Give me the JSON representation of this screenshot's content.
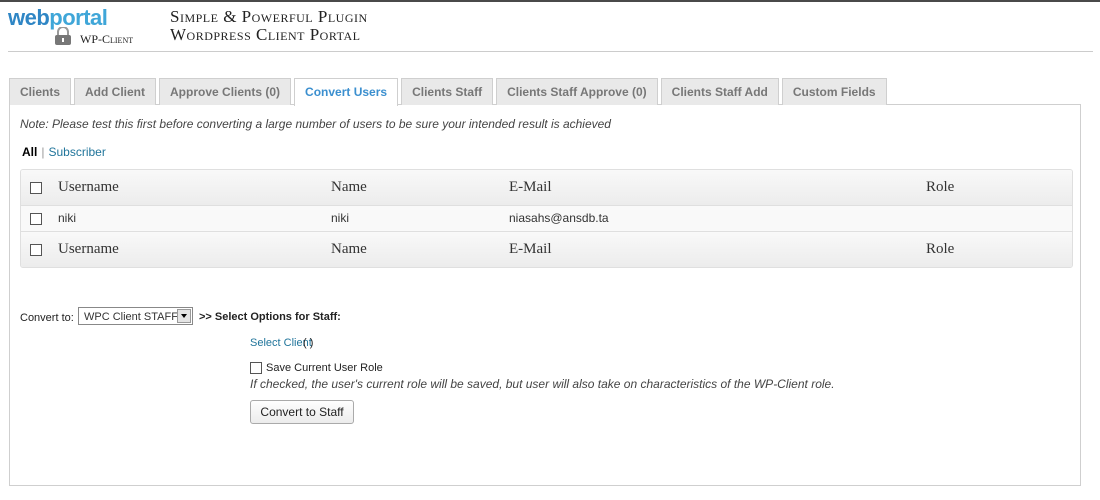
{
  "header": {
    "logo_main_a": "web",
    "logo_main_b": "portal",
    "logo_sub": "WP-Client",
    "tagline_line1": "Simple & Powerful Plugin",
    "tagline_line2": "Wordpress Client Portal"
  },
  "tabs": [
    {
      "label": "Clients",
      "active": false
    },
    {
      "label": "Add Client",
      "active": false
    },
    {
      "label": "Approve Clients (0)",
      "active": false
    },
    {
      "label": "Convert Users",
      "active": true
    },
    {
      "label": "Clients Staff",
      "active": false
    },
    {
      "label": "Clients Staff Approve (0)",
      "active": false
    },
    {
      "label": "Clients Staff Add",
      "active": false
    },
    {
      "label": "Custom Fields",
      "active": false
    }
  ],
  "note": "Note: Please test this first before converting a large number of users to be sure your intended result is achieved",
  "filters": {
    "all": "All",
    "separator": "|",
    "subscriber": "Subscriber"
  },
  "table": {
    "columns": [
      "Username",
      "Name",
      "E-Mail",
      "Role"
    ],
    "rows": [
      {
        "username": "niki",
        "name": "niki",
        "email": "niasahs@ansdb.ta",
        "role": ""
      }
    ]
  },
  "convert": {
    "label": "Convert to:",
    "selected": "WPC Client STAFF",
    "options_heading": ">> Select Options for Staff:",
    "select_client": "Select Client",
    "select_client_value": "( )",
    "save_role_label": "Save Current User Role",
    "save_role_hint": "If checked, the user's current role will be saved, but user will also take on characteristics of the WP-Client role.",
    "button": "Convert to Staff"
  },
  "colors": {
    "accent": "#3b8fcf",
    "link": "#21759b",
    "tab_bg": "#e9e9e9"
  }
}
